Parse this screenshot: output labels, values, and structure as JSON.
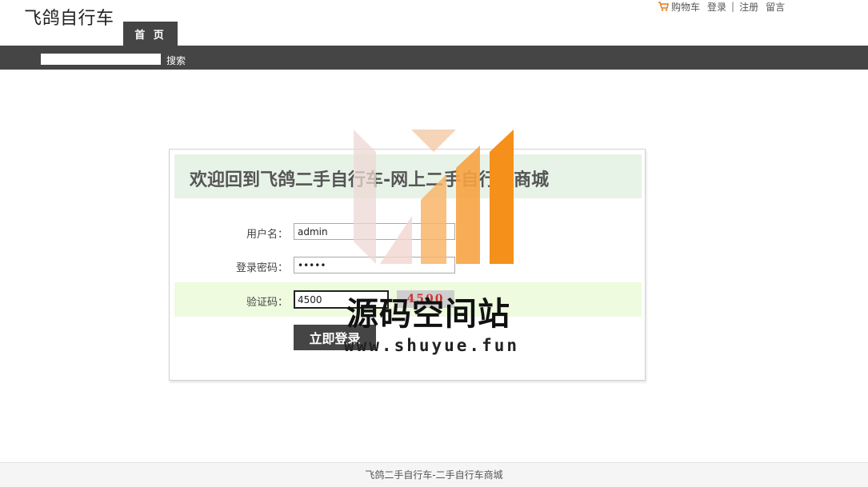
{
  "header": {
    "site_title": "飞鸽自行车",
    "top_links": {
      "cart": "购物车",
      "login": "登录",
      "separator": "|",
      "register": "注册",
      "message": "留言"
    },
    "nav_tab_home": "首 页",
    "search": {
      "value": "",
      "placeholder": "",
      "button_label": "搜索"
    }
  },
  "login": {
    "title": "欢迎回到飞鸽二手自行车-网上二手自行车商城",
    "username_label": "用户名：",
    "username_value": "admin",
    "password_label": "登录密码：",
    "password_value": "•••••",
    "captcha_label": "验证码：",
    "captcha_value": "4500",
    "captcha_image_text": "4500",
    "submit_label": "立即登录"
  },
  "watermark": {
    "text": "源码空间站",
    "url": "www.shuyue.fun"
  },
  "footer": {
    "text": "飞鸽二手自行车-二手自行车商城"
  },
  "colors": {
    "nav_bg": "#454545",
    "header_bg": "#e8f3e8",
    "captcha_row_bg": "#eefbdf",
    "watermark_orange": "#f5901a"
  }
}
